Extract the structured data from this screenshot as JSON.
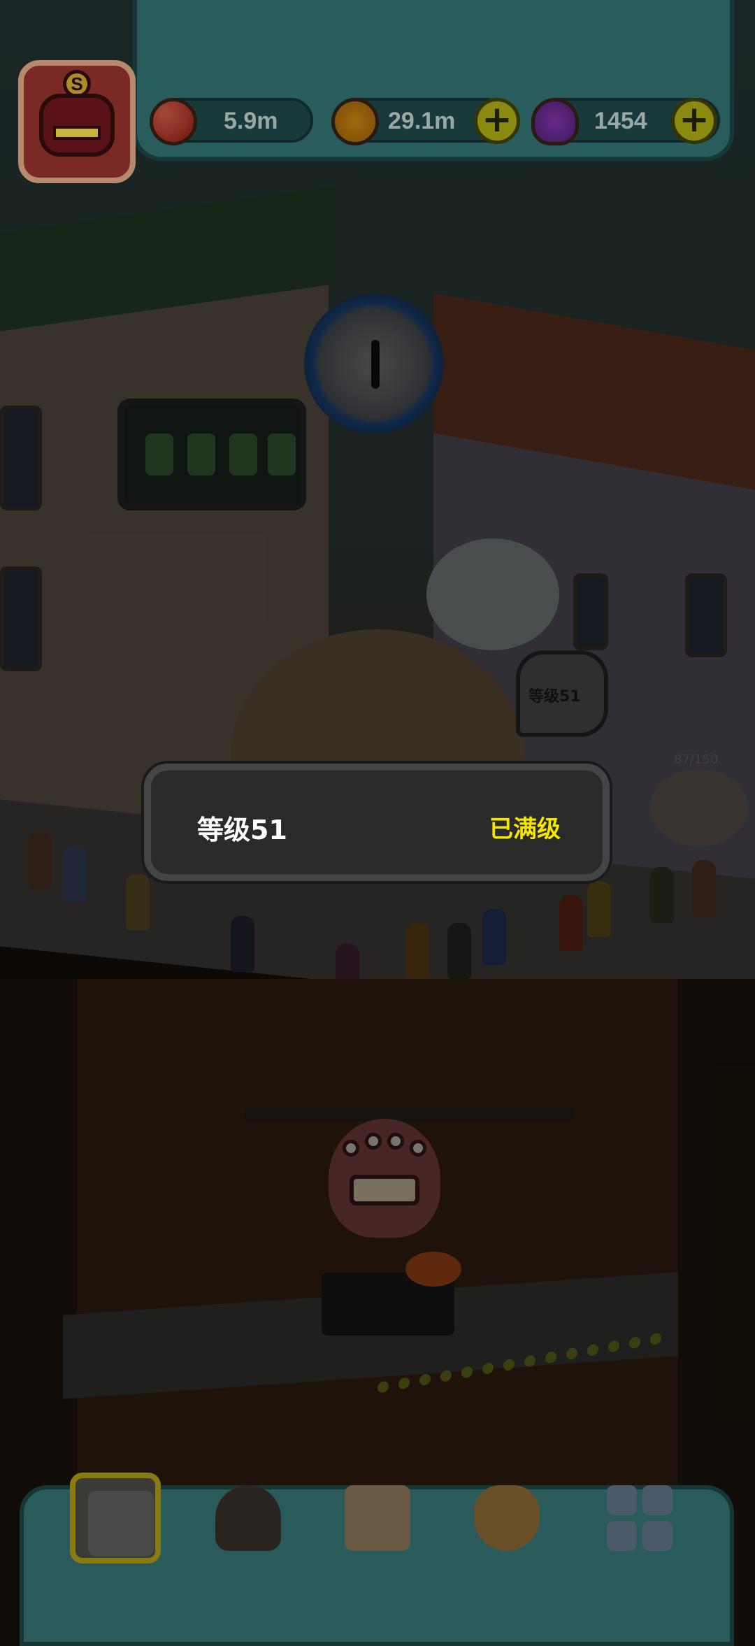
{
  "hud": {
    "avatar_badge": "S",
    "resources": [
      {
        "name": "eyeballs",
        "icon": "eyeball-icon",
        "value": "5.9m",
        "has_plus": false
      },
      {
        "name": "coins",
        "icon": "coin-icon",
        "value": "29.1m",
        "has_plus": true
      },
      {
        "name": "potions",
        "icon": "potion-icon",
        "value": "1454",
        "has_plus": true
      }
    ],
    "plus_symbol": "+"
  },
  "scene": {
    "speech_bubble_text": "等级51",
    "order_progress": "87/150"
  },
  "popup": {
    "title": "等级51",
    "status": "已满级"
  },
  "bottom_nav": {
    "items": [
      {
        "name": "restaurant",
        "icon": "restaurant-icon",
        "active": true
      },
      {
        "name": "monster",
        "icon": "monster-icon",
        "active": false
      },
      {
        "name": "recipe-book",
        "icon": "book-icon",
        "active": false
      },
      {
        "name": "shop",
        "icon": "money-bag-icon",
        "active": false
      },
      {
        "name": "more",
        "icon": "grid-icon",
        "active": false
      }
    ]
  },
  "colors": {
    "popup_status": "#f6e600",
    "hud_panel": "#2b6262",
    "plus_button": "#8a8a10"
  }
}
